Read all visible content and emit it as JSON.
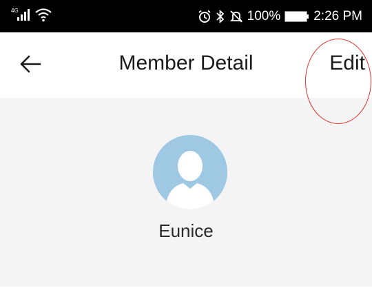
{
  "status_bar": {
    "network_label": "4G",
    "battery_percent": "100%",
    "time": "2:26 PM",
    "icons": [
      "signal-icon",
      "wifi-icon",
      "alarm-icon",
      "bluetooth-icon",
      "mute-icon",
      "battery-icon"
    ]
  },
  "header": {
    "title": "Member Detail",
    "edit_label": "Edit",
    "back_icon": "arrow-left-icon"
  },
  "member": {
    "name": "Eunice",
    "avatar_icon": "default-avatar-icon"
  },
  "colors": {
    "status_bar_bg": "#000000",
    "header_bg": "#ffffff",
    "content_bg": "#f4f4f4",
    "avatar_bg": "#9fc8e3",
    "annotation_circle": "#e0302a"
  }
}
